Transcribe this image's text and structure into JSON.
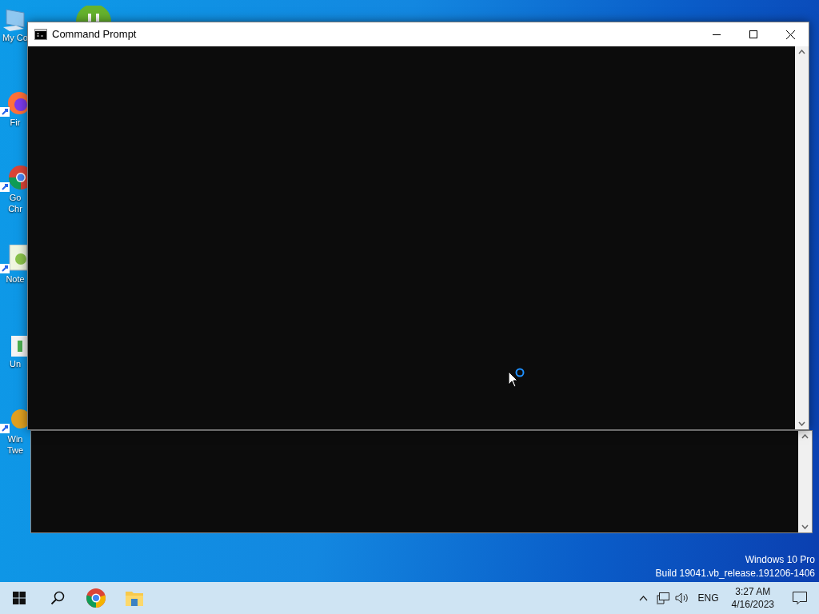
{
  "desktop_icons": [
    {
      "kind": "computer",
      "label": [
        "My Co"
      ]
    },
    {
      "kind": "firefox",
      "label": [
        "Fir"
      ]
    },
    {
      "kind": "chrome",
      "label": [
        "Go",
        "Chr"
      ]
    },
    {
      "kind": "notepad",
      "label": [
        "Note"
      ]
    },
    {
      "kind": "app",
      "label": [
        "Un"
      ]
    },
    {
      "kind": "tweaker",
      "label": [
        "Win",
        "Twe"
      ]
    }
  ],
  "window": {
    "title": "Command Prompt"
  },
  "watermark": [
    "Windows 10 Pro",
    "Build 19041.vb_release.191206-1406"
  ],
  "taskbar": {
    "pinned": [
      {
        "kind": "start"
      },
      {
        "kind": "search"
      },
      {
        "kind": "chrome"
      },
      {
        "kind": "explorer"
      }
    ],
    "tray": {
      "language": "ENG",
      "time": "3:27 AM",
      "date": "4/16/2023"
    }
  }
}
